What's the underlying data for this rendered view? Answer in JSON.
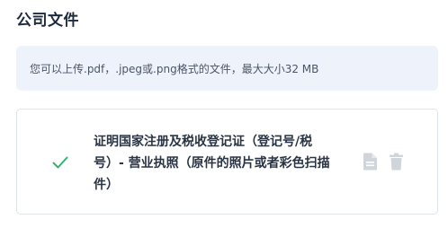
{
  "section": {
    "title": "公司文件"
  },
  "notice": {
    "text": "您可以上传.pdf，.jpeg或.png格式的文件，最大大小32 MB"
  },
  "document": {
    "status_icon": "check-icon",
    "label": "证明国家注册及税收登记证（登记号/税号）- 营业执照（原件的照片或者彩色扫描件）",
    "actions": [
      "file-icon",
      "trash-icon"
    ]
  },
  "colors": {
    "check": "#2bb673",
    "notice_bg": "#eef2fb",
    "icon_gray": "#d0d4db"
  }
}
